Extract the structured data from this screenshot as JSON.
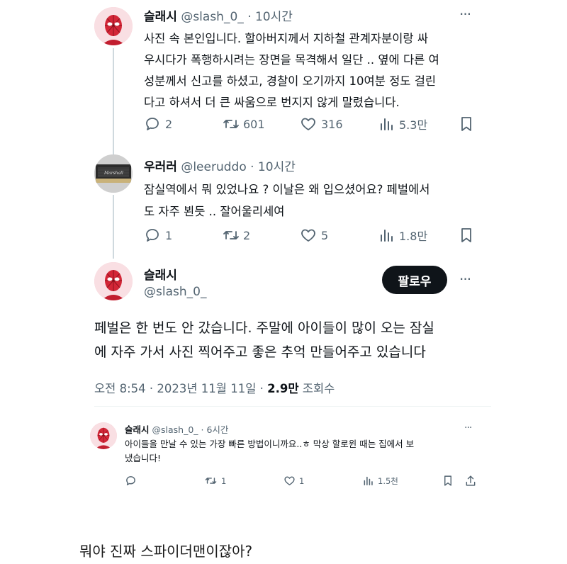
{
  "tweet1": {
    "name": "슬래시",
    "handle": "@slash_0_",
    "time": "· 10시간",
    "lines": [
      "사진 속 본인입니다. 할아버지께서 지하철 관계자분이랑 싸",
      "우시다가 폭행하시려는 장면을 목격해서 일단 .. 옆에 다른 여",
      "성분께서 신고를 하셨고, 경찰이 오기까지 10여분 정도 걸린",
      "다고 하셔서 더 큰 싸움으로 번지지 않게 말렸습니다."
    ],
    "replies": "2",
    "retweets": "601",
    "likes": "316",
    "views": "5.3만"
  },
  "tweet2": {
    "name": "우러러",
    "handle": "@leeruddo",
    "time": "· 10시간",
    "lines": [
      "잠실역에서 뭐 있었나요 ? 이날은 왜 입으셨어요?  페벌에서",
      "도 자주 뵌듯 .. 잘어울리세여"
    ],
    "replies": "1",
    "retweets": "2",
    "likes": "5",
    "views": "1.8만"
  },
  "tweet3": {
    "name": "슬래시",
    "handle": "@slash_0_",
    "follow": "팔로우",
    "lines": [
      "페벌은 한 번도 안 갔습니다. 주말에 아이들이 많이 오는 잠실",
      "에 자주 가서 사진 찍어주고 좋은 추억 만들어주고 있습니다"
    ],
    "meta_time": "오전 8:54 · 2023년 11월 11일 · ",
    "meta_views": "2.9만",
    "meta_views_label": " 조회수"
  },
  "tweet4": {
    "name": "슬래시",
    "handle": "@slash_0_",
    "time": "· 6시간",
    "lines": [
      "아이들을 만날 수 있는 가장 빠른 방법이니까요..ㅎ 막상 할로윈 때는 집에서 보",
      "냈습니다!"
    ],
    "retweets": "1",
    "likes": "1",
    "views": "1.5천"
  },
  "caption": "뭐야 진짜 스파이더맨이잖아?",
  "icons": {
    "reply": "reply-icon",
    "retweet": "retweet-icon",
    "like": "heart-icon",
    "views": "views-icon",
    "bookmark": "bookmark-icon",
    "share": "share-icon",
    "more": "more-icon"
  },
  "colors": {
    "text": "#0f1419",
    "secondary": "#536471",
    "thread_line": "#cfd9de",
    "follow_bg": "#0f1419"
  }
}
